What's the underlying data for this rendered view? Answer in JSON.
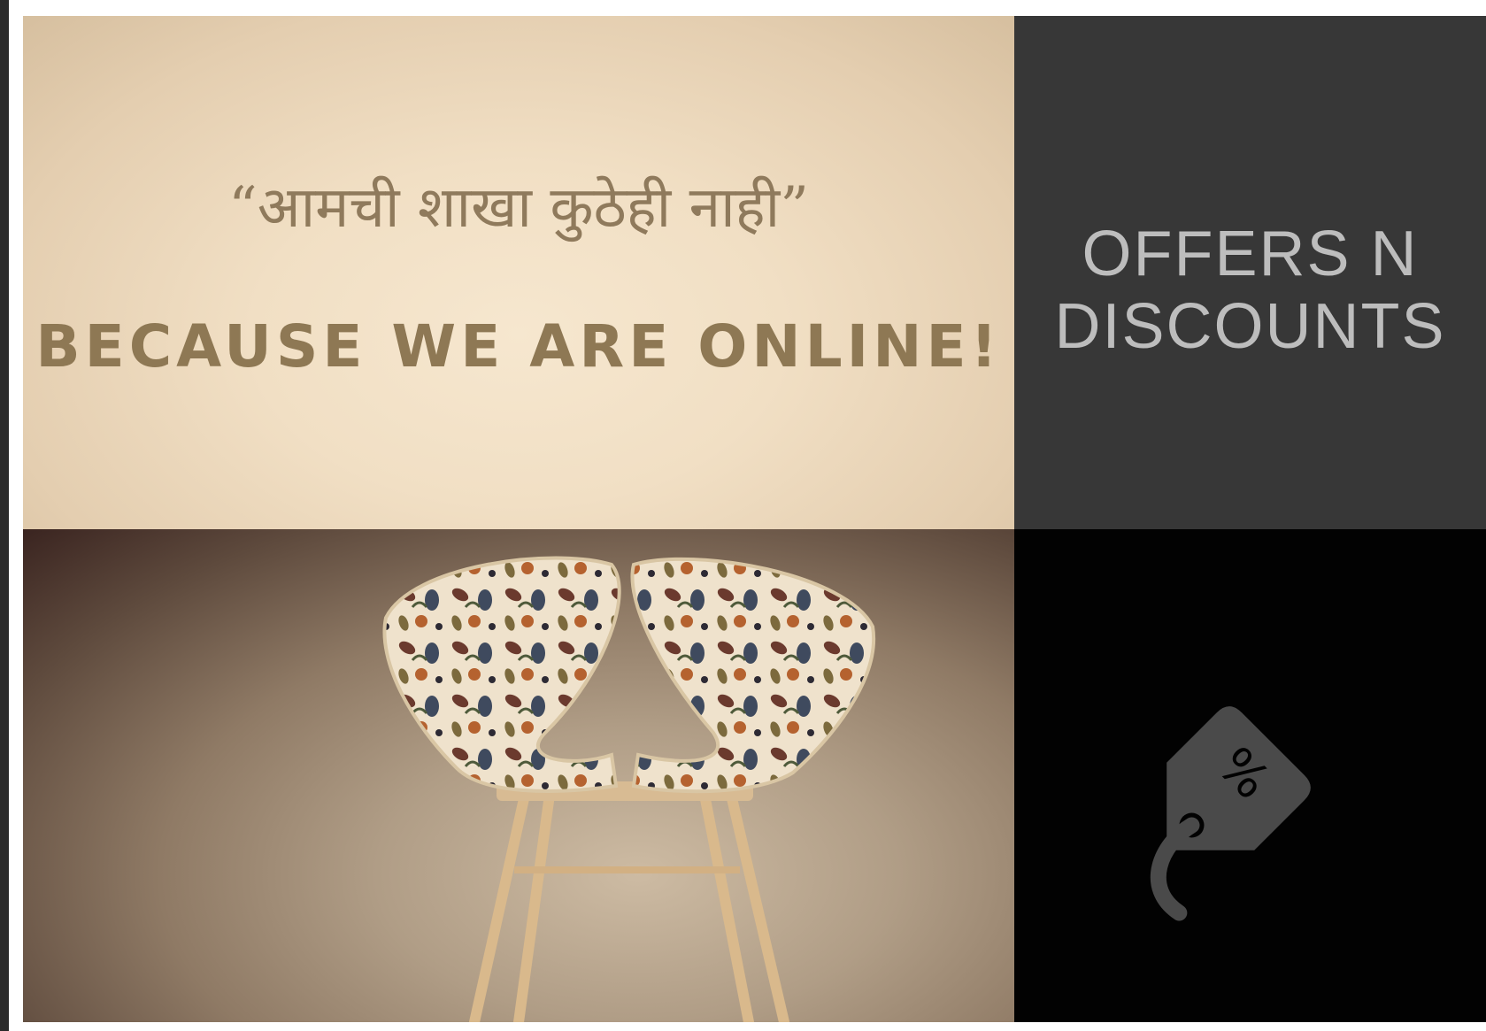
{
  "banner": {
    "marathi_line": "“आमची शाखा कुठेही नाही”",
    "english_line": "BECAUSE WE ARE ONLINE!"
  },
  "offers": {
    "line1": "OFFERS N",
    "line2": "DISCOUNTS"
  },
  "icons": {
    "chair": "upholstered-chair-photo",
    "tag": "discount-tag-icon"
  },
  "colors": {
    "banner_text": "#8e7854",
    "offers_bg": "#373737",
    "offers_text": "#bdbdbd",
    "tag_bg": "#020202",
    "tag_icon": "#4a4a4a"
  }
}
